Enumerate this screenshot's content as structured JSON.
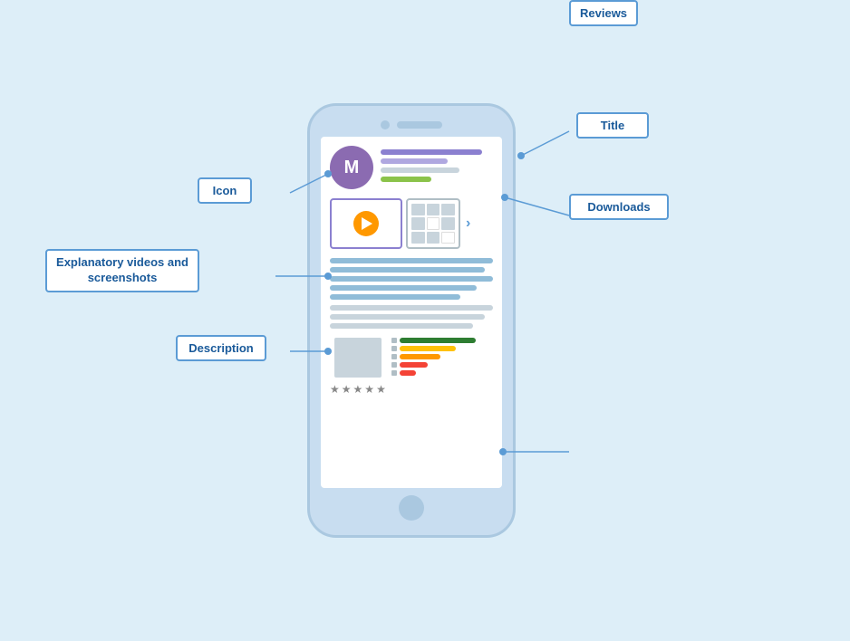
{
  "labels": {
    "title": "Title",
    "icon": "Icon",
    "downloads": "Downloads",
    "explanatory": "Explanatory videos and\nscreenshots",
    "description": "Description",
    "reviews": "Reviews"
  },
  "phone": {
    "app_icon_letter": "M"
  },
  "colors": {
    "bg": "#ddeef8",
    "phone_body": "#c8ddf0",
    "accent": "#5b9bd5",
    "label_border": "#5b9bd5",
    "label_text": "#1a5a9a"
  }
}
